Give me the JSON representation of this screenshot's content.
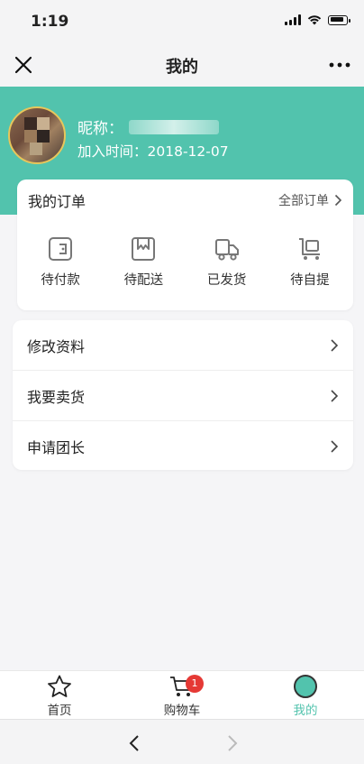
{
  "status_bar": {
    "time": "1:19"
  },
  "nav": {
    "title": "我的",
    "close_icon": "close-icon",
    "more_icon": "more-icon"
  },
  "profile": {
    "nickname_label": "昵称：",
    "join_label": "加入时间：",
    "join_date": "2018-12-07"
  },
  "orders": {
    "title": "我的订单",
    "all_label": "全部订单",
    "items": [
      {
        "label": "待付款",
        "icon": "wallet-icon"
      },
      {
        "label": "待配送",
        "icon": "package-icon"
      },
      {
        "label": "已发货",
        "icon": "truck-icon"
      },
      {
        "label": "待自提",
        "icon": "cart-pickup-icon"
      }
    ]
  },
  "menu": {
    "items": [
      {
        "label": "修改资料"
      },
      {
        "label": "我要卖货"
      },
      {
        "label": "申请团长"
      }
    ]
  },
  "tabbar": {
    "items": [
      {
        "label": "首页",
        "icon": "star-icon"
      },
      {
        "label": "购物车",
        "icon": "cart-icon",
        "badge": "1"
      },
      {
        "label": "我的",
        "icon": "avatar-icon"
      }
    ]
  },
  "colors": {
    "accent": "#52c3ad",
    "badge": "#e53935"
  }
}
